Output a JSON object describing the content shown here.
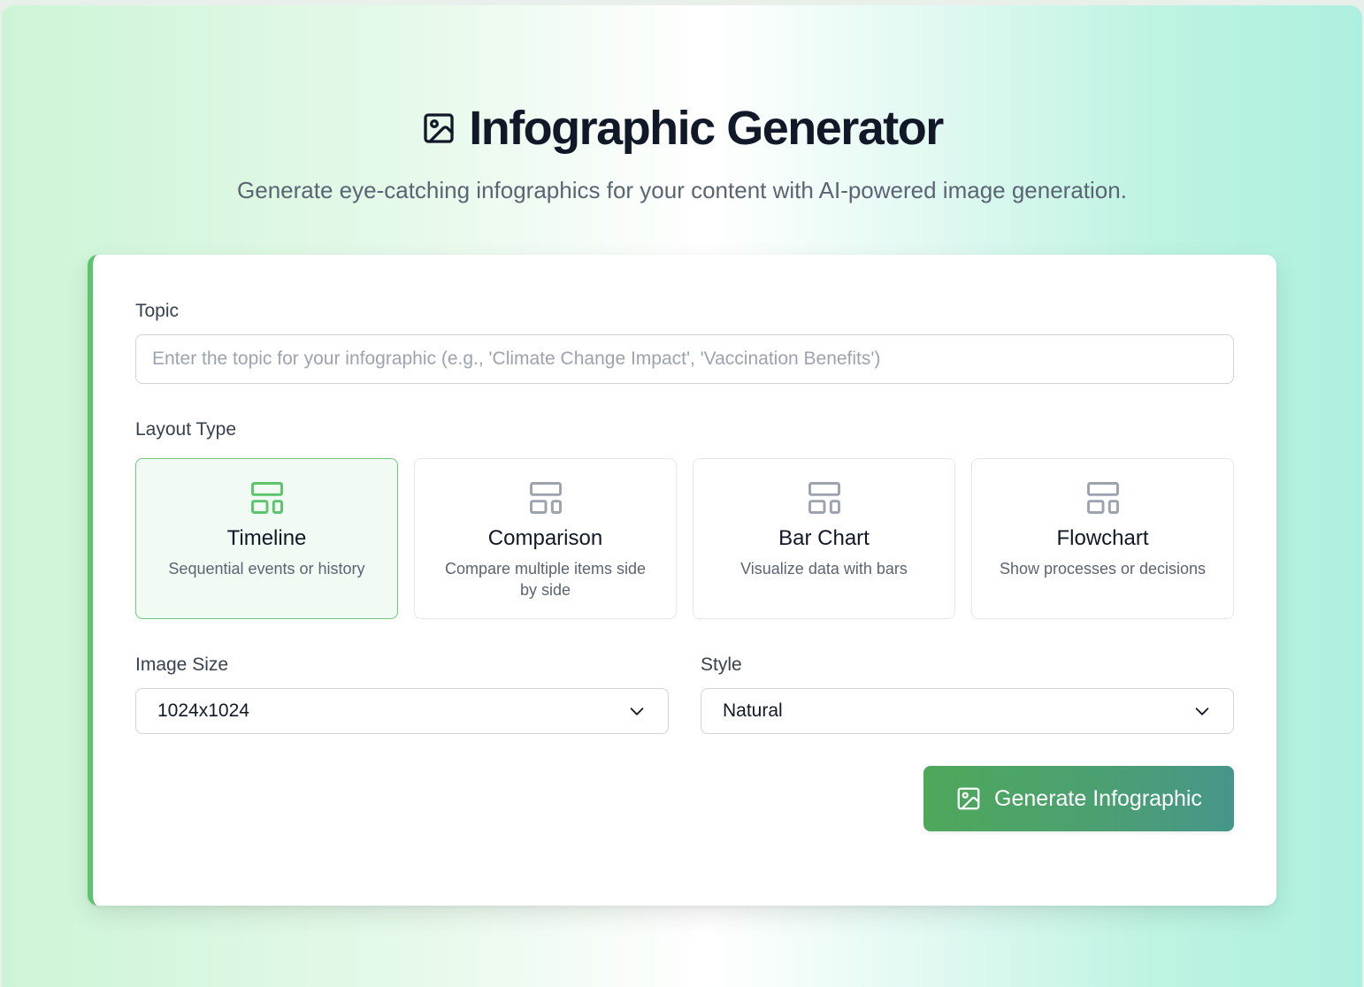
{
  "header": {
    "title": "Infographic Generator",
    "subtitle": "Generate eye-catching infographics for your content with AI-powered image generation.",
    "icon": "image-icon"
  },
  "form": {
    "topic": {
      "label": "Topic",
      "value": "",
      "placeholder": "Enter the topic for your infographic (e.g., 'Climate Change Impact', 'Vaccination Benefits')"
    },
    "layout": {
      "label": "Layout Type",
      "selected": "Timeline",
      "options": [
        {
          "name": "Timeline",
          "description": "Sequential events or history",
          "icon": "layout-icon"
        },
        {
          "name": "Comparison",
          "description": "Compare multiple items side by side",
          "icon": "layout-icon"
        },
        {
          "name": "Bar Chart",
          "description": "Visualize data with bars",
          "icon": "layout-icon"
        },
        {
          "name": "Flowchart",
          "description": "Show processes or decisions",
          "icon": "layout-icon"
        }
      ]
    },
    "image_size": {
      "label": "Image Size",
      "value": "1024x1024"
    },
    "style": {
      "label": "Style",
      "value": "Natural"
    },
    "generate_button": {
      "label": "Generate Infographic",
      "icon": "image-icon"
    }
  },
  "colors": {
    "accent": "#5cc46a",
    "selected_icon": "#5cc46a",
    "unselected_icon": "#9ca3af",
    "button_start": "#4ea85a",
    "button_end": "#46968a",
    "title": "#111827"
  }
}
